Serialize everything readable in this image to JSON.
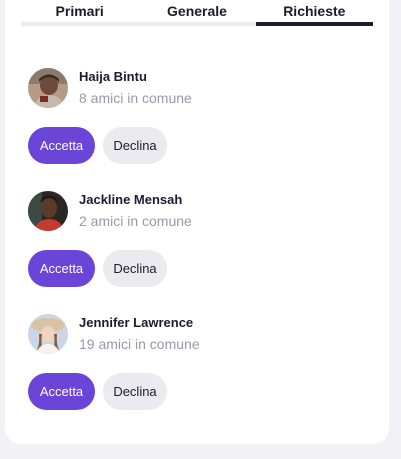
{
  "tabs": [
    {
      "label": "Primari",
      "active": false
    },
    {
      "label": "Generale",
      "active": false
    },
    {
      "label": "Richieste",
      "active": true
    }
  ],
  "requests": [
    {
      "name": "Haija Bintu",
      "mutual": "8 amici in comune",
      "accept_label": "Accetta",
      "decline_label": "Declina"
    },
    {
      "name": "Jackline Mensah",
      "mutual": "2 amici in comune",
      "accept_label": "Accetta",
      "decline_label": "Declina"
    },
    {
      "name": "Jennifer Lawrence",
      "mutual": "19 amici in comune",
      "accept_label": "Accetta",
      "decline_label": "Declina"
    }
  ],
  "colors": {
    "accent": "#6a45d8",
    "decline_bg": "#ebeaee",
    "text_dark": "#1d1b2e",
    "text_muted": "#9a98a8",
    "page_bg": "#f2f1f6"
  }
}
